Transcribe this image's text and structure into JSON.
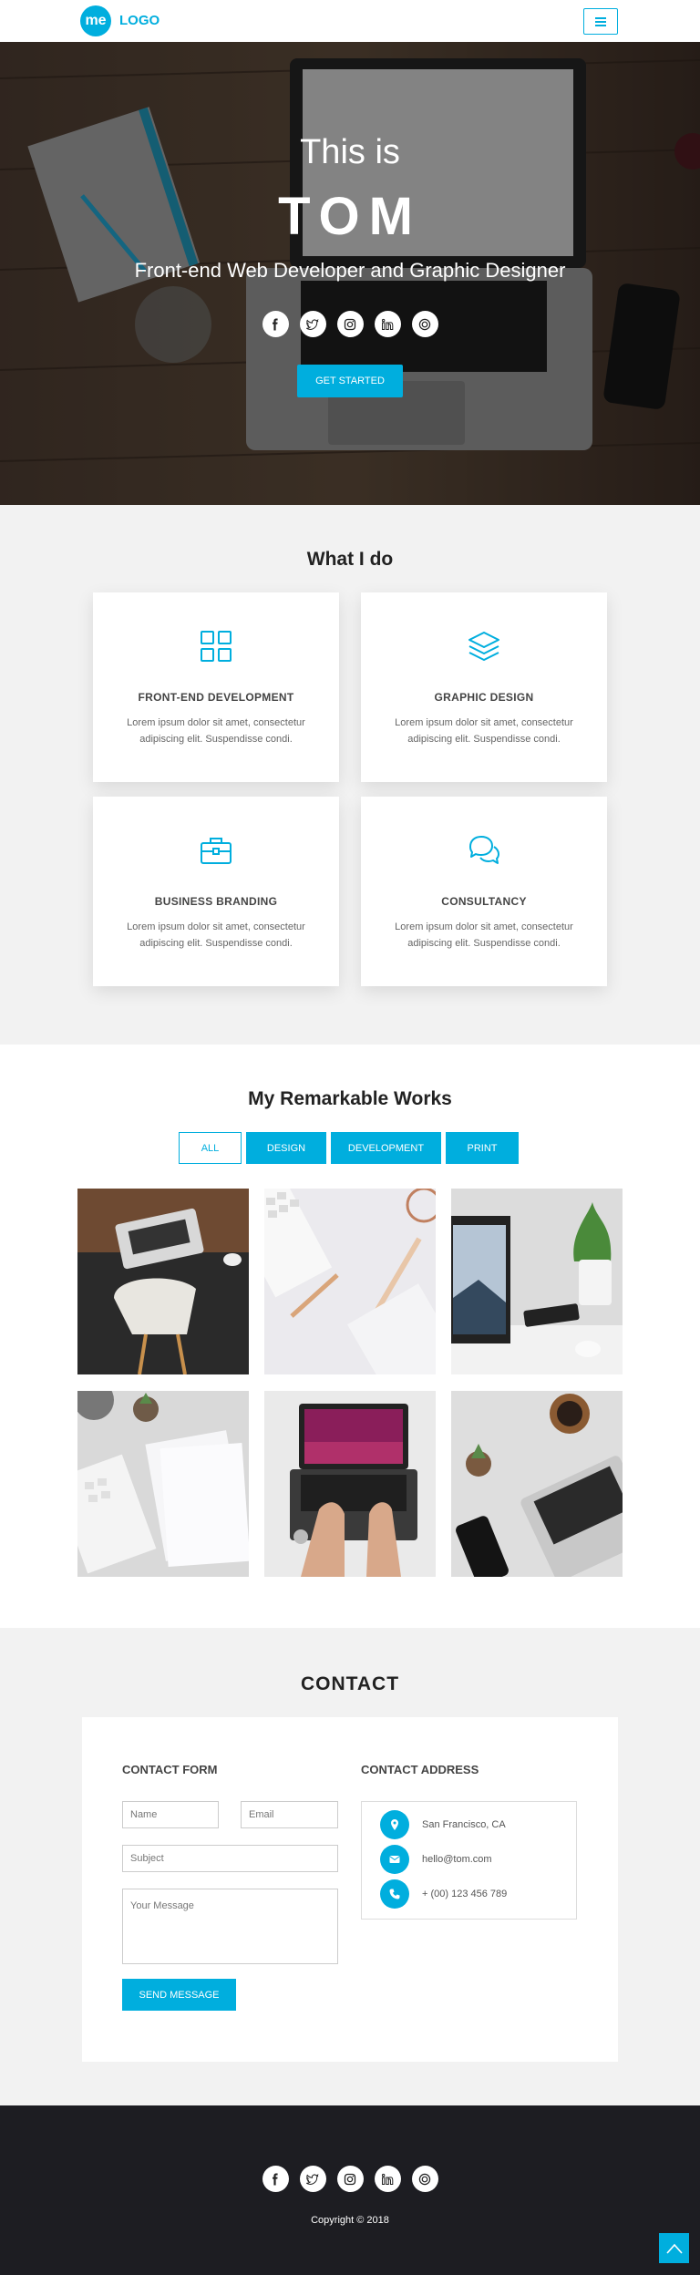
{
  "nav": {
    "logo_mark": "me",
    "logo_text": "LOGO",
    "menu_icon": "hamburger-menu-icon"
  },
  "hero": {
    "title_line1": "This is",
    "title_line2": "TOM",
    "subtitle": "Front-end Web Developer and Graphic Designer",
    "social_icons": [
      "facebook-icon",
      "twitter-icon",
      "instagram-icon",
      "linkedin-icon",
      "dribbble-icon"
    ],
    "cta_label": "GET STARTED"
  },
  "services": {
    "title": "What I do",
    "cards": [
      {
        "icon": "grid-icon",
        "title": "FRONT-END DEVELOPMENT",
        "text": "Lorem ipsum dolor sit amet, consectetur adipiscing elit. Suspendisse condi."
      },
      {
        "icon": "layers-icon",
        "title": "GRAPHIC DESIGN",
        "text": "Lorem ipsum dolor sit amet, consectetur adipiscing elit. Suspendisse condi."
      },
      {
        "icon": "briefcase-icon",
        "title": "BUSINESS BRANDING",
        "text": "Lorem ipsum dolor sit amet, consectetur adipiscing elit. Suspendisse condi."
      },
      {
        "icon": "chat-bubbles-icon",
        "title": "CONSULTANCY",
        "text": "Lorem ipsum dolor sit amet, consectetur adipiscing elit. Suspendisse condi."
      }
    ]
  },
  "works": {
    "title": "My Remarkable Works",
    "filters": [
      "ALL",
      "DESIGN",
      "DEVELOPMENT",
      "PRINT"
    ],
    "active_filter": "ALL"
  },
  "contact": {
    "title": "CONTACT",
    "form_title": "CONTACT FORM",
    "name_placeholder": "Name",
    "email_placeholder": "Email",
    "subject_placeholder": "Subject",
    "message_placeholder": "Your Message",
    "send_label": "SEND MESSAGE",
    "address_title": "CONTACT ADDRESS",
    "address": "San Francisco, CA",
    "email": "hello@tom.com",
    "phone": "+ (00) 123 456 789"
  },
  "footer": {
    "social_icons": [
      "facebook-icon",
      "twitter-icon",
      "instagram-icon",
      "linkedin-icon",
      "dribbble-icon"
    ],
    "copyright": "Copyright © 2018",
    "back_to_top_icon": "chevron-up-icon"
  },
  "colors": {
    "accent": "#00aede",
    "light_bg": "#f2f2f2",
    "footer_bg": "#1d1d22"
  }
}
